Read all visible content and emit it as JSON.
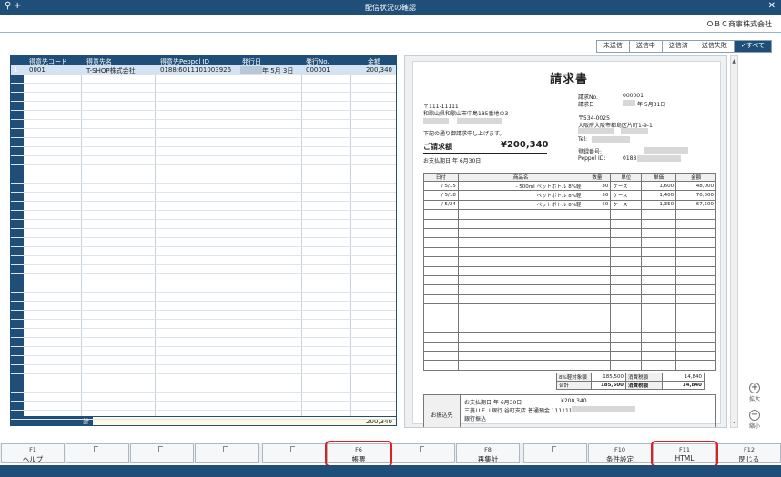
{
  "window": {
    "title": "配信状況の確認",
    "company": "ＯＢＣ商事株式会社"
  },
  "filters": [
    {
      "label": "未送信",
      "active": false
    },
    {
      "label": "送信中",
      "active": false
    },
    {
      "label": "送信済",
      "active": false
    },
    {
      "label": "送信失敗",
      "active": false
    },
    {
      "label": "✓すべて",
      "active": true
    }
  ],
  "grid": {
    "columns": [
      "得意先コード",
      "得意先名",
      "得意先Peppol ID",
      "発行日",
      "発行No.",
      "金額"
    ],
    "rows": [
      {
        "no": "1",
        "code": "0001",
        "name": "T-SHOP株式会社",
        "peppol": "0188:6011101003926",
        "date": "年  5月  3日",
        "docno": "000001",
        "amount": "200,340"
      }
    ],
    "total_label": "計",
    "total_amount": "200,340"
  },
  "invoice": {
    "title": "請求書",
    "postal": "〒111-11111",
    "address": "和歌山県和歌山市中島185番地の3",
    "greeting": "下記の通り御請求申し上げます。",
    "total_label": "ご請求額",
    "total_amount": "¥200,340",
    "due": "お支払期日        年 6月30日",
    "doc_no_label": "請求No.",
    "doc_no": "000001",
    "doc_date_label": "請求日",
    "doc_date": "年 5月31日",
    "sender_postal": "〒534-0025",
    "sender_address": "大阪府大阪市都島区片町1-9-1",
    "tel_label": "Tel:",
    "reg_label": "登録番号:",
    "peppol_label": "Peppol ID:",
    "peppol_prefix": "0188",
    "headers": [
      "日付",
      "商品名",
      "数量",
      "単位",
      "単価",
      "金額"
    ],
    "items": [
      {
        "date": "/ 5/15",
        "name": "- 500ml ペットボトル",
        "tax": "8%軽",
        "qty": "30",
        "unit": "ケース",
        "price": "1,600",
        "amount": "48,000"
      },
      {
        "date": "/ 5/18",
        "name": "ペットボトル",
        "tax": "8%軽",
        "qty": "50",
        "unit": "ケース",
        "price": "1,400",
        "amount": "70,000"
      },
      {
        "date": "/ 5/24",
        "name": "ペットボトル",
        "tax": "8%軽",
        "qty": "50",
        "unit": "ケース",
        "price": "1,350",
        "amount": "67,500"
      }
    ],
    "sum_taxable_label": "8%軽対象額",
    "sum_taxable": "185,500",
    "sum_tax_label": "消費税額",
    "sum_tax": "14,840",
    "sum_total_label": "合計",
    "sum_total": "185,500",
    "sum_tax2_label": "消費税額",
    "sum_tax2": "14,840",
    "bank_header": "お振込先",
    "bank_line1": "お支払期日        年 6月30日",
    "bank_line1_amount": "¥200,340",
    "bank_line2": "三菱ＵＦＪ銀行 谷町支店 普通預金 1111111",
    "bank_line3": "銀行振込"
  },
  "zoom": {
    "in_label": "拡大",
    "out_label": "縮小"
  },
  "fkeys": [
    {
      "key": "F1",
      "label": "ヘルプ"
    },
    {
      "key": "",
      "label": ""
    },
    {
      "key": "",
      "label": ""
    },
    {
      "key": "",
      "label": ""
    },
    {
      "key": "",
      "label": ""
    },
    {
      "key": "F6",
      "label": "帳票"
    },
    {
      "key": "",
      "label": ""
    },
    {
      "key": "F8",
      "label": "再集計"
    },
    {
      "key": "",
      "label": ""
    },
    {
      "key": "F10",
      "label": "条件設定"
    },
    {
      "key": "F11",
      "label": "HTML"
    },
    {
      "key": "F12",
      "label": "閉じる"
    }
  ]
}
